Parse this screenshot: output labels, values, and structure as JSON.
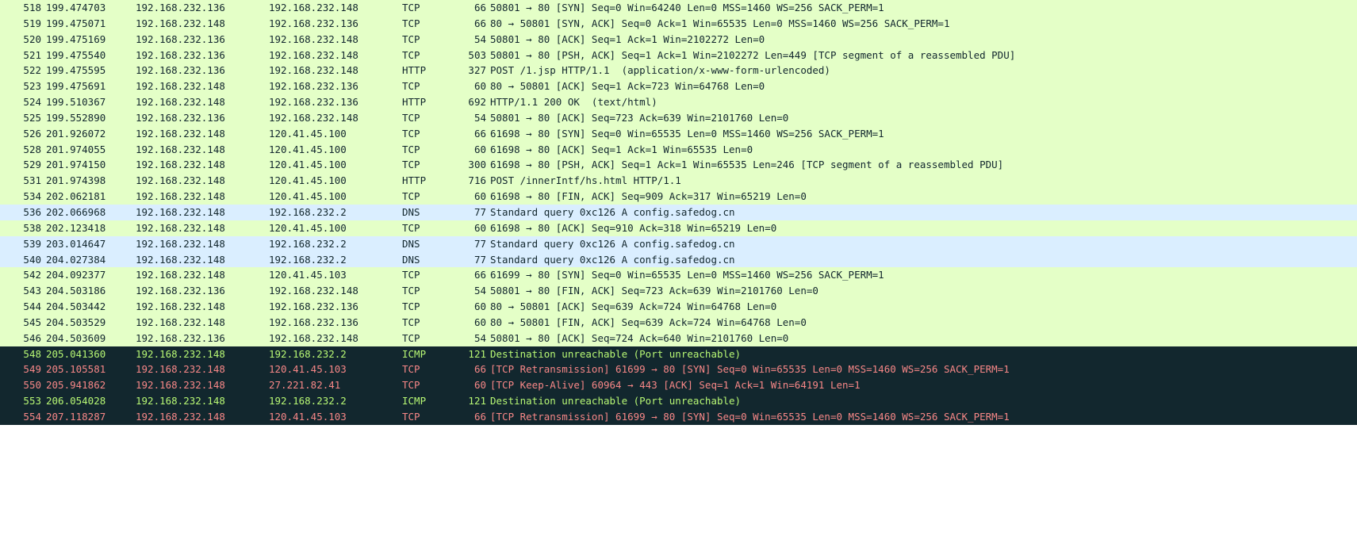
{
  "packets": [
    {
      "no": "518",
      "time": "199.474703",
      "src": "192.168.232.136",
      "dst": "192.168.232.148",
      "proto": "TCP",
      "len": "66",
      "info": "50801 → 80 [SYN] Seq=0 Win=64240 Len=0 MSS=1460 WS=256 SACK_PERM=1",
      "style": "tcp"
    },
    {
      "no": "519",
      "time": "199.475071",
      "src": "192.168.232.148",
      "dst": "192.168.232.136",
      "proto": "TCP",
      "len": "66",
      "info": "80 → 50801 [SYN, ACK] Seq=0 Ack=1 Win=65535 Len=0 MSS=1460 WS=256 SACK_PERM=1",
      "style": "tcp"
    },
    {
      "no": "520",
      "time": "199.475169",
      "src": "192.168.232.136",
      "dst": "192.168.232.148",
      "proto": "TCP",
      "len": "54",
      "info": "50801 → 80 [ACK] Seq=1 Ack=1 Win=2102272 Len=0",
      "style": "tcp"
    },
    {
      "no": "521",
      "time": "199.475540",
      "src": "192.168.232.136",
      "dst": "192.168.232.148",
      "proto": "TCP",
      "len": "503",
      "info": "50801 → 80 [PSH, ACK] Seq=1 Ack=1 Win=2102272 Len=449 [TCP segment of a reassembled PDU]",
      "style": "tcp"
    },
    {
      "no": "522",
      "time": "199.475595",
      "src": "192.168.232.136",
      "dst": "192.168.232.148",
      "proto": "HTTP",
      "len": "327",
      "info": "POST /1.jsp HTTP/1.1  (application/x-www-form-urlencoded)",
      "style": "http"
    },
    {
      "no": "523",
      "time": "199.475691",
      "src": "192.168.232.148",
      "dst": "192.168.232.136",
      "proto": "TCP",
      "len": "60",
      "info": "80 → 50801 [ACK] Seq=1 Ack=723 Win=64768 Len=0",
      "style": "tcp"
    },
    {
      "no": "524",
      "time": "199.510367",
      "src": "192.168.232.148",
      "dst": "192.168.232.136",
      "proto": "HTTP",
      "len": "692",
      "info": "HTTP/1.1 200 OK  (text/html)",
      "style": "http"
    },
    {
      "no": "525",
      "time": "199.552890",
      "src": "192.168.232.136",
      "dst": "192.168.232.148",
      "proto": "TCP",
      "len": "54",
      "info": "50801 → 80 [ACK] Seq=723 Ack=639 Win=2101760 Len=0",
      "style": "tcp"
    },
    {
      "no": "526",
      "time": "201.926072",
      "src": "192.168.232.148",
      "dst": "120.41.45.100",
      "proto": "TCP",
      "len": "66",
      "info": "61698 → 80 [SYN] Seq=0 Win=65535 Len=0 MSS=1460 WS=256 SACK_PERM=1",
      "style": "tcp"
    },
    {
      "no": "528",
      "time": "201.974055",
      "src": "192.168.232.148",
      "dst": "120.41.45.100",
      "proto": "TCP",
      "len": "60",
      "info": "61698 → 80 [ACK] Seq=1 Ack=1 Win=65535 Len=0",
      "style": "tcp"
    },
    {
      "no": "529",
      "time": "201.974150",
      "src": "192.168.232.148",
      "dst": "120.41.45.100",
      "proto": "TCP",
      "len": "300",
      "info": "61698 → 80 [PSH, ACK] Seq=1 Ack=1 Win=65535 Len=246 [TCP segment of a reassembled PDU]",
      "style": "tcp"
    },
    {
      "no": "531",
      "time": "201.974398",
      "src": "192.168.232.148",
      "dst": "120.41.45.100",
      "proto": "HTTP",
      "len": "716",
      "info": "POST /innerIntf/hs.html HTTP/1.1",
      "style": "http"
    },
    {
      "no": "534",
      "time": "202.062181",
      "src": "192.168.232.148",
      "dst": "120.41.45.100",
      "proto": "TCP",
      "len": "60",
      "info": "61698 → 80 [FIN, ACK] Seq=909 Ack=317 Win=65219 Len=0",
      "style": "tcp"
    },
    {
      "no": "536",
      "time": "202.066968",
      "src": "192.168.232.148",
      "dst": "192.168.232.2",
      "proto": "DNS",
      "len": "77",
      "info": "Standard query 0xc126 A config.safedog.cn",
      "style": "dns"
    },
    {
      "no": "538",
      "time": "202.123418",
      "src": "192.168.232.148",
      "dst": "120.41.45.100",
      "proto": "TCP",
      "len": "60",
      "info": "61698 → 80 [ACK] Seq=910 Ack=318 Win=65219 Len=0",
      "style": "tcp"
    },
    {
      "no": "539",
      "time": "203.014647",
      "src": "192.168.232.148",
      "dst": "192.168.232.2",
      "proto": "DNS",
      "len": "77",
      "info": "Standard query 0xc126 A config.safedog.cn",
      "style": "dns"
    },
    {
      "no": "540",
      "time": "204.027384",
      "src": "192.168.232.148",
      "dst": "192.168.232.2",
      "proto": "DNS",
      "len": "77",
      "info": "Standard query 0xc126 A config.safedog.cn",
      "style": "dns"
    },
    {
      "no": "542",
      "time": "204.092377",
      "src": "192.168.232.148",
      "dst": "120.41.45.103",
      "proto": "TCP",
      "len": "66",
      "info": "61699 → 80 [SYN] Seq=0 Win=65535 Len=0 MSS=1460 WS=256 SACK_PERM=1",
      "style": "tcp"
    },
    {
      "no": "543",
      "time": "204.503186",
      "src": "192.168.232.136",
      "dst": "192.168.232.148",
      "proto": "TCP",
      "len": "54",
      "info": "50801 → 80 [FIN, ACK] Seq=723 Ack=639 Win=2101760 Len=0",
      "style": "tcp"
    },
    {
      "no": "544",
      "time": "204.503442",
      "src": "192.168.232.148",
      "dst": "192.168.232.136",
      "proto": "TCP",
      "len": "60",
      "info": "80 → 50801 [ACK] Seq=639 Ack=724 Win=64768 Len=0",
      "style": "tcp"
    },
    {
      "no": "545",
      "time": "204.503529",
      "src": "192.168.232.148",
      "dst": "192.168.232.136",
      "proto": "TCP",
      "len": "60",
      "info": "80 → 50801 [FIN, ACK] Seq=639 Ack=724 Win=64768 Len=0",
      "style": "tcp"
    },
    {
      "no": "546",
      "time": "204.503609",
      "src": "192.168.232.136",
      "dst": "192.168.232.148",
      "proto": "TCP",
      "len": "54",
      "info": "50801 → 80 [ACK] Seq=724 Ack=640 Win=2101760 Len=0",
      "style": "tcp"
    },
    {
      "no": "548",
      "time": "205.041360",
      "src": "192.168.232.148",
      "dst": "192.168.232.2",
      "proto": "ICMP",
      "len": "121",
      "info": "Destination unreachable (Port unreachable)",
      "style": "icmp"
    },
    {
      "no": "549",
      "time": "205.105581",
      "src": "192.168.232.148",
      "dst": "120.41.45.103",
      "proto": "TCP",
      "len": "66",
      "info": "[TCP Retransmission] 61699 → 80 [SYN] Seq=0 Win=65535 Len=0 MSS=1460 WS=256 SACK_PERM=1",
      "style": "err"
    },
    {
      "no": "550",
      "time": "205.941862",
      "src": "192.168.232.148",
      "dst": "27.221.82.41",
      "proto": "TCP",
      "len": "60",
      "info": "[TCP Keep-Alive] 60964 → 443 [ACK] Seq=1 Ack=1 Win=64191 Len=1",
      "style": "err"
    },
    {
      "no": "553",
      "time": "206.054028",
      "src": "192.168.232.148",
      "dst": "192.168.232.2",
      "proto": "ICMP",
      "len": "121",
      "info": "Destination unreachable (Port unreachable)",
      "style": "icmp"
    },
    {
      "no": "554",
      "time": "207.118287",
      "src": "192.168.232.148",
      "dst": "120.41.45.103",
      "proto": "TCP",
      "len": "66",
      "info": "[TCP Retransmission] 61699 → 80 [SYN] Seq=0 Win=65535 Len=0 MSS=1460 WS=256 SACK_PERM=1",
      "style": "err"
    }
  ],
  "colors": {
    "tcp_bg": "#e4ffc7",
    "dns_bg": "#daeeff",
    "dark_bg": "#12272e",
    "icmp_fg": "#b7f774",
    "error_fg": "#f78787",
    "text_fg": "#12272e"
  }
}
